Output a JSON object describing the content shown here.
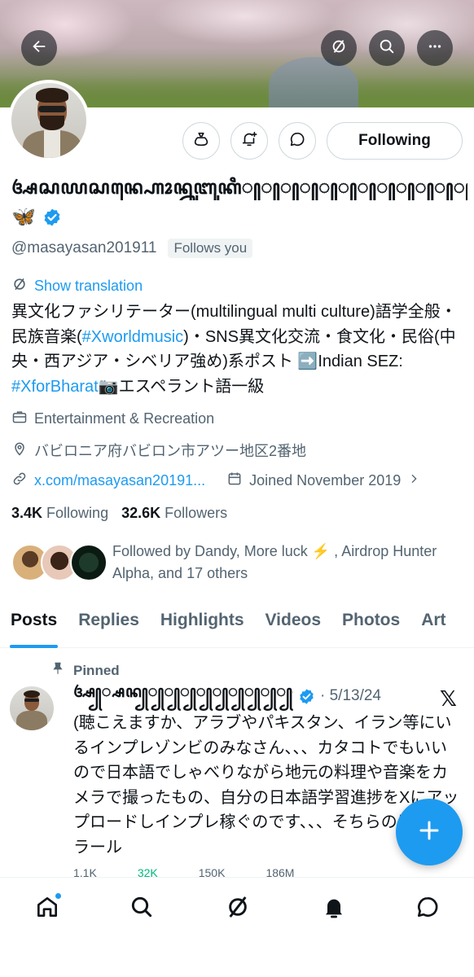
{
  "header": {
    "back_icon": "arrow-left-icon",
    "grok_icon": "grok-icon",
    "search_icon": "search-icon",
    "more_icon": "more-horizontal-icon"
  },
  "profile": {
    "display_name": "ꦄꦱꦪꦱꦤ꧀ꦲꦺꦴꦤ꧀ꦤꦸꦧꦸꦏꦶ꧀꧀꧀꧀꧀꧀꧀꧀꧀꧀꧀꧀꧀꧀꧀꧀꧀꧀꧀꧀",
    "name_emoji": "🦋",
    "verified_color": "#1d9bf0",
    "handle": "@masayasan201911",
    "follows_you": "Follows you",
    "show_translation": "Show translation",
    "bio_parts": {
      "p1": "異文化ファシリテーター(multilingual multi culture)語学全般・民族音楽(",
      "tag1": "#Xworldmusic",
      "p2": ")・SNS異文化交流・食文化・民俗(中央・西アジア・シベリア強め)系ポスト ➡️Indian SEZ: ",
      "tag2": "#XforBharat",
      "p3": "📷エスペラント語一級"
    },
    "category": "Entertainment & Recreation",
    "location": "バビロニア府バビロン市アツー地区2番地",
    "website": "x.com/masayasan20191...",
    "joined": "Joined November 2019",
    "following_count": "3.4K",
    "following_label": "Following",
    "followers_count": "32.6K",
    "followers_label": "Followers",
    "followed_by": "Followed by Dandy, More luck ⚡️ , Airdrop Hunter Alpha, and 17 others"
  },
  "actions": {
    "following_button": "Following",
    "tip_icon": "money-bag-icon",
    "notify_icon": "bell-plus-icon",
    "message_icon": "message-icon"
  },
  "tabs": [
    {
      "label": "Posts",
      "active": true
    },
    {
      "label": "Replies"
    },
    {
      "label": "Highlights"
    },
    {
      "label": "Videos"
    },
    {
      "label": "Photos"
    },
    {
      "label": "Art"
    }
  ],
  "post": {
    "pinned_label": "Pinned",
    "author": "ꦄ꧀꧀ꦱꦤ꧀꧀꧀꧀꧀꧀꧀꧀꧀꧀꧀꧀꧀꧀꧀꧀꧀꧀꧀",
    "date": "· 5/13/24",
    "text": "(聴こえますか、アラブやパキスタン、イラン等にいるインプレゾンビのみなさん、、、カタコトでもいいので日本語でしゃべりながら地元の料理や音楽をカメラで撮ったもの、自分の日本語学習進捗をXにアップロードしインプレ稼ぐのです、、、そちらのほうがハラール",
    "replies": "1.1K",
    "reposts": "32K",
    "likes": "150K",
    "views": "186M"
  },
  "colors": {
    "accent": "#1d9bf0",
    "repost": "#00ba7c",
    "secondary_text": "#536471"
  }
}
